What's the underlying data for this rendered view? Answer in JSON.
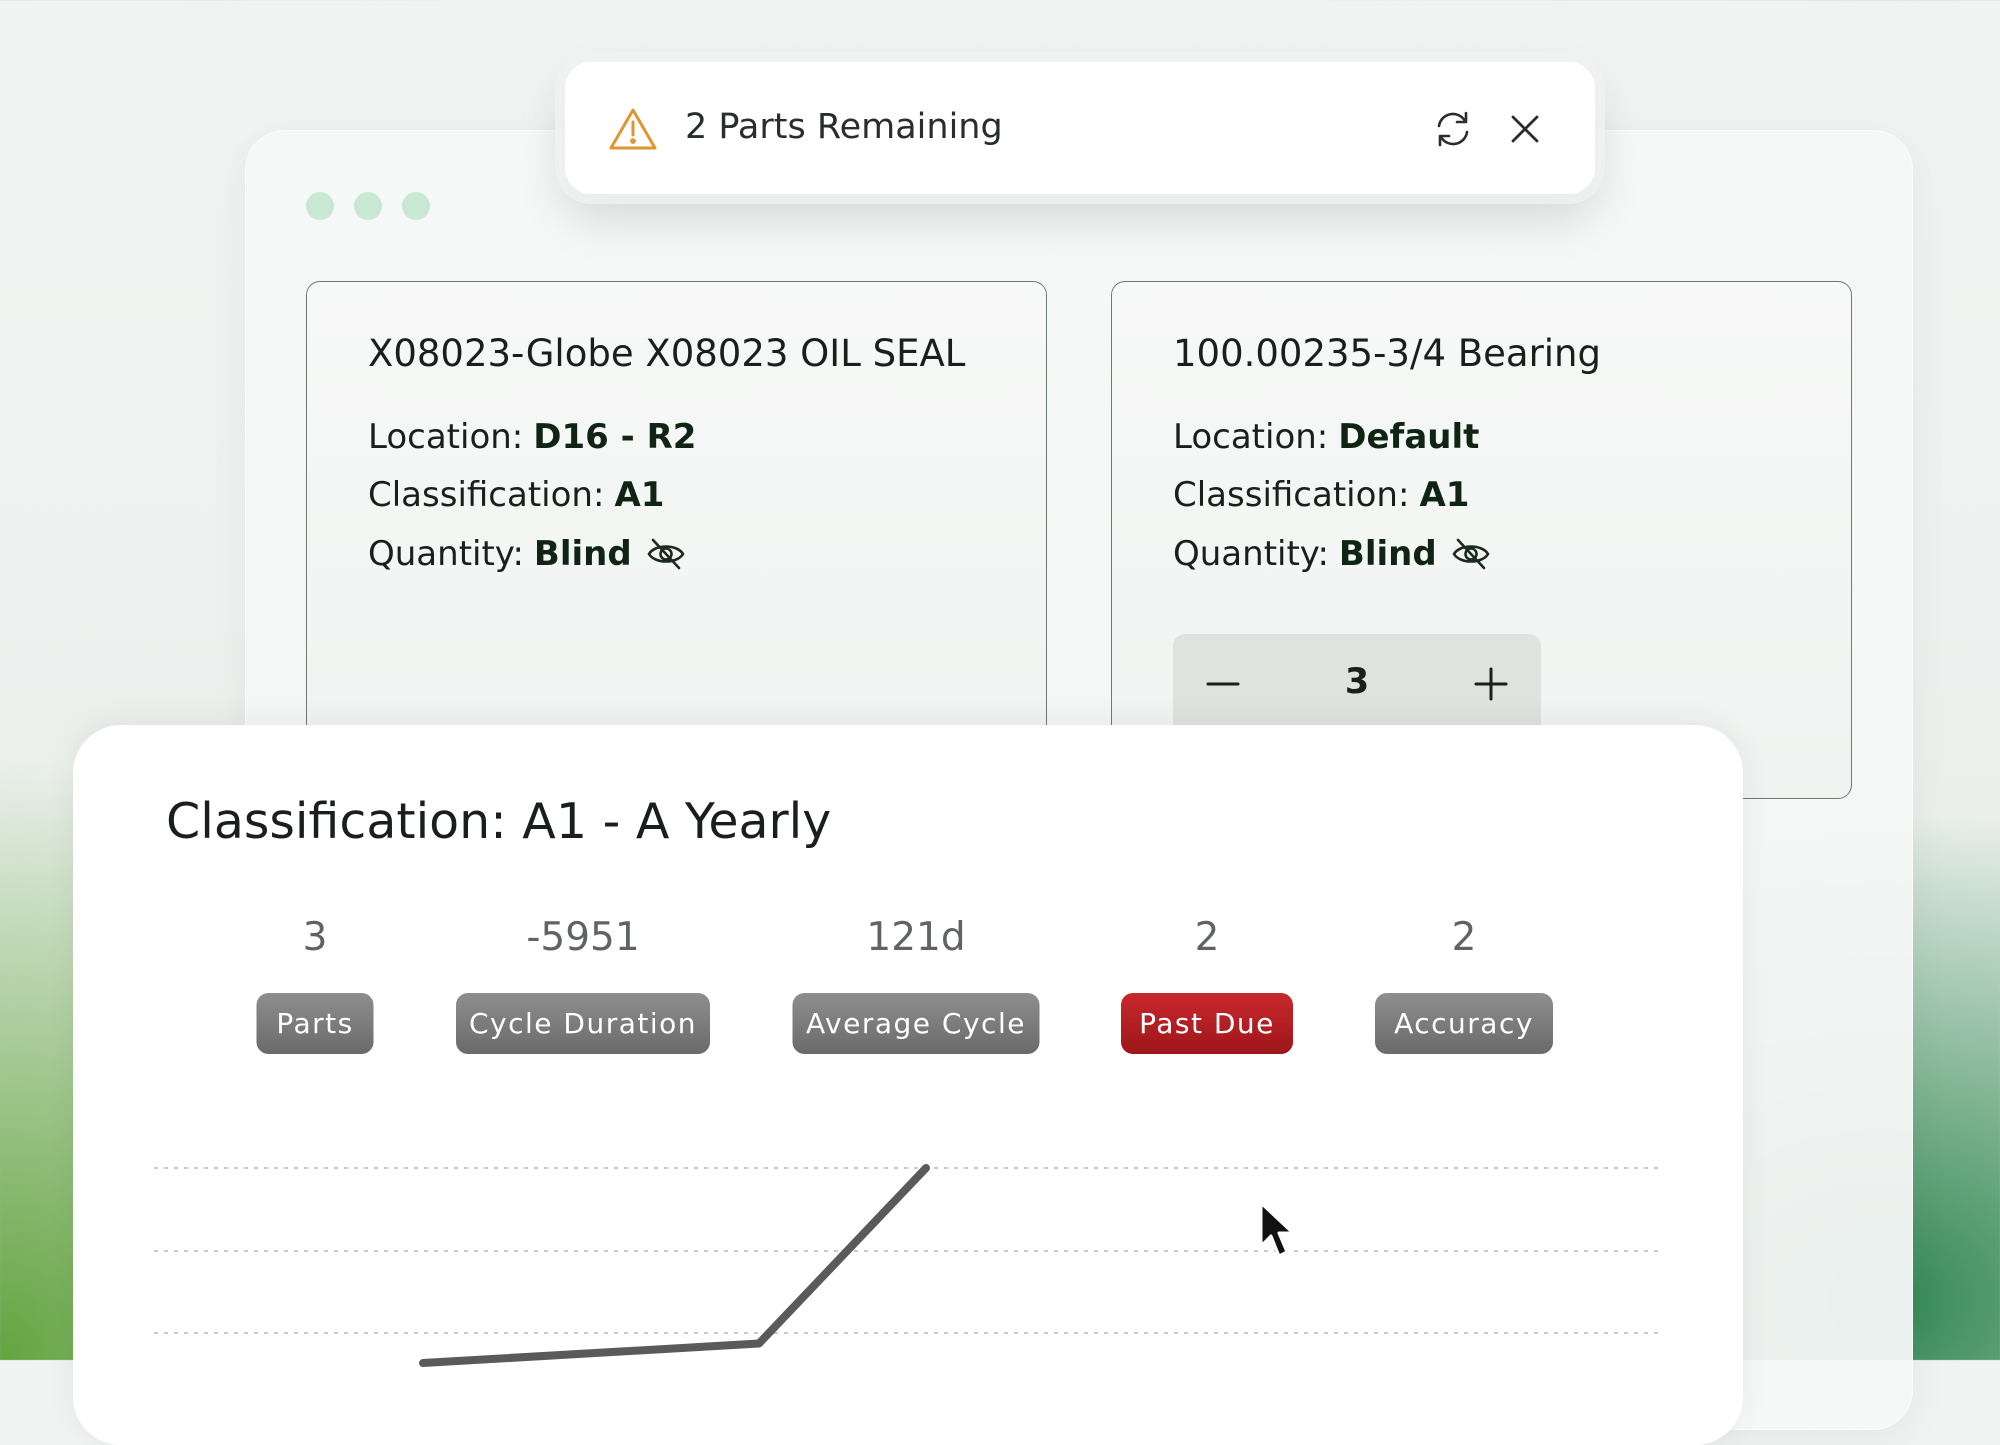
{
  "toast": {
    "message": "2 Parts Remaining",
    "icons": {
      "warning": "warning-icon",
      "refresh": "refresh-icon",
      "close": "close-icon"
    },
    "warning_color": "#e0962e"
  },
  "window": {
    "dots_color": "#c9e8d3"
  },
  "parts": [
    {
      "title": "X08023-Globe X08023 OIL SEAL",
      "location_label": "Location:",
      "location": "D16 - R2",
      "classification_label": "Classification:",
      "classification": "A1",
      "quantity_label": "Quantity:",
      "quantity": "Blind"
    },
    {
      "title": "100.00235-3/4 Bearing",
      "location_label": "Location:",
      "location": "Default",
      "classification_label": "Classification:",
      "classification": "A1",
      "quantity_label": "Quantity:",
      "quantity": "Blind",
      "stepper_value": "3"
    }
  ],
  "summary": {
    "title": "Classification: A1 - A Yearly",
    "stats": [
      {
        "value": "3",
        "label": "Parts",
        "status": "neutral"
      },
      {
        "value": "-5951",
        "label": "Cycle Duration",
        "status": "neutral"
      },
      {
        "value": "121d",
        "label": "Average Cycle",
        "status": "neutral"
      },
      {
        "value": "2",
        "label": "Past Due",
        "status": "danger"
      },
      {
        "value": "2",
        "label": "Accuracy",
        "status": "neutral"
      }
    ]
  },
  "chart_data": {
    "type": "line",
    "grid": true,
    "series": [
      {
        "values": [
          0,
          0.2,
          2
        ]
      }
    ]
  },
  "colors": {
    "danger": "#b51d22",
    "badge_neutral": "#7a7a7a",
    "line": "#5a5a5a"
  }
}
